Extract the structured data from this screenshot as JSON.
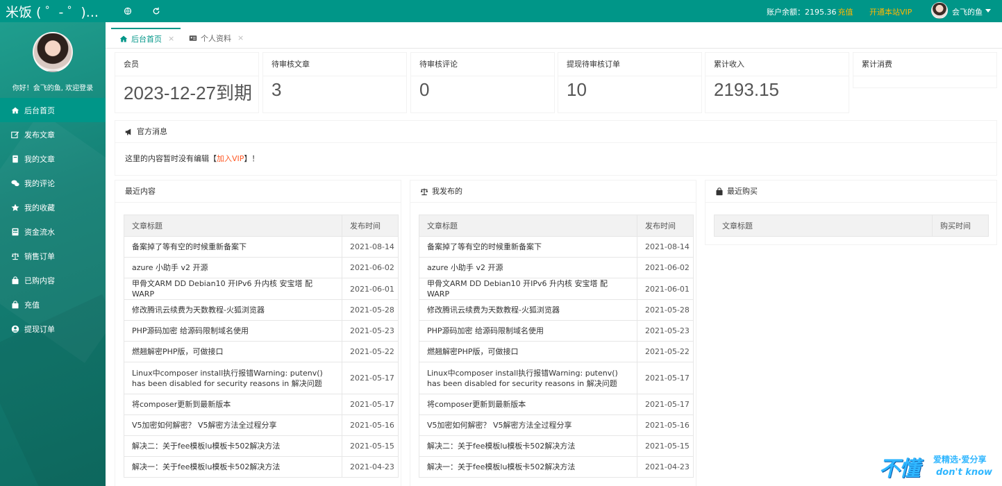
{
  "header": {
    "brand": "米饭 ( ゜- ゜)...",
    "balance_label": "账户余额：2195.36",
    "recharge_link": "充值",
    "vip_link": "开通本站VIP",
    "user_name": "会飞的鱼"
  },
  "sidebar": {
    "welcome": "你好！会飞的鱼, 欢迎登录",
    "items": [
      {
        "label": "后台首页",
        "icon": "home-icon",
        "active": true
      },
      {
        "label": "发布文章",
        "icon": "edit-icon"
      },
      {
        "label": "我的文章",
        "icon": "book-icon"
      },
      {
        "label": "我的评论",
        "icon": "comments-icon"
      },
      {
        "label": "我的收藏",
        "icon": "star-icon"
      },
      {
        "label": "资金流水",
        "icon": "calculator-icon"
      },
      {
        "label": "销售订单",
        "icon": "balance-scale-icon"
      },
      {
        "label": "已购内容",
        "icon": "shopping-bag-icon"
      },
      {
        "label": "充值",
        "icon": "shopping-bag-icon"
      },
      {
        "label": "提现订单",
        "icon": "user-circle-icon"
      }
    ]
  },
  "tabs": [
    {
      "label": "后台首页",
      "icon": "home-icon",
      "active": true
    },
    {
      "label": "个人资料",
      "icon": "id-card-icon"
    }
  ],
  "stats": [
    {
      "label": "会员",
      "value": "2023-12-27到期"
    },
    {
      "label": "待审核文章",
      "value": "3"
    },
    {
      "label": "待审核评论",
      "value": "0"
    },
    {
      "label": "提现待审核订单",
      "value": "10"
    },
    {
      "label": "累计收入",
      "value": "2193.15"
    },
    {
      "label": "累计消费",
      "value": ""
    }
  ],
  "notice": {
    "title": "官方消息",
    "text_before": "这里的内容暂时没有编辑【",
    "link": "加入VIP",
    "text_after": "】！"
  },
  "recent": {
    "title": "最近内容",
    "col_title": "文章标题",
    "col_date": "发布时间",
    "rows": [
      {
        "title": "备案掉了等有空的时候重新备案下",
        "date": "2021-08-14"
      },
      {
        "title": "azure 小助手 v2 开源",
        "date": "2021-06-02"
      },
      {
        "title": "甲骨文ARM DD Debian10 开IPv6 升内核 安宝塔 配WARP",
        "date": "2021-06-01"
      },
      {
        "title": "修改腾讯云续费为天数教程-火狐浏览器",
        "date": "2021-05-28"
      },
      {
        "title": "PHP源码加密 给源码限制域名使用",
        "date": "2021-05-23"
      },
      {
        "title": "燃翘解密PHP版，可做接口",
        "date": "2021-05-22"
      },
      {
        "title": "Linux中composer install执行报错Warning: putenv() has been disabled for security reasons in 解决问题",
        "date": "2021-05-17"
      },
      {
        "title": "将composer更新到最新版本",
        "date": "2021-05-17"
      },
      {
        "title": "V5加密如何解密？ V5解密方法全过程分享",
        "date": "2021-05-16"
      },
      {
        "title": "解决二：关于fee模板lu模板卡502解决方法",
        "date": "2021-05-15"
      },
      {
        "title": "解决一：关于fee模板lu模板卡502解决方法",
        "date": "2021-04-23"
      }
    ]
  },
  "mine": {
    "title": "我发布的",
    "col_title": "文章标题",
    "col_date": "发布时间",
    "rows": [
      {
        "title": "备案掉了等有空的时候重新备案下",
        "date": "2021-08-14"
      },
      {
        "title": "azure 小助手 v2 开源",
        "date": "2021-06-02"
      },
      {
        "title": "甲骨文ARM DD Debian10 开IPv6 升内核 安宝塔 配WARP",
        "date": "2021-06-01"
      },
      {
        "title": "修改腾讯云续费为天数教程-火狐浏览器",
        "date": "2021-05-28"
      },
      {
        "title": "PHP源码加密 给源码限制域名使用",
        "date": "2021-05-23"
      },
      {
        "title": "燃翘解密PHP版，可做接口",
        "date": "2021-05-22"
      },
      {
        "title": "Linux中composer install执行报错Warning: putenv() has been disabled for security reasons in 解决问题",
        "date": "2021-05-17"
      },
      {
        "title": "将composer更新到最新版本",
        "date": "2021-05-17"
      },
      {
        "title": "V5加密如何解密？ V5解密方法全过程分享",
        "date": "2021-05-16"
      },
      {
        "title": "解决二：关于fee模板lu模板卡502解决方法",
        "date": "2021-05-15"
      },
      {
        "title": "解决一：关于fee模板lu模板卡502解决方法",
        "date": "2021-04-23"
      }
    ]
  },
  "purchases": {
    "title": "最近购买",
    "col_title": "文章标题",
    "col_date": "购买时间"
  },
  "watermark": {
    "big": "不懂",
    "small1": "爱精选·爱分享",
    "small2": "don't know"
  },
  "colors": {
    "primary": "#009688",
    "accent": "#ffb800",
    "link": "#ff5722"
  }
}
